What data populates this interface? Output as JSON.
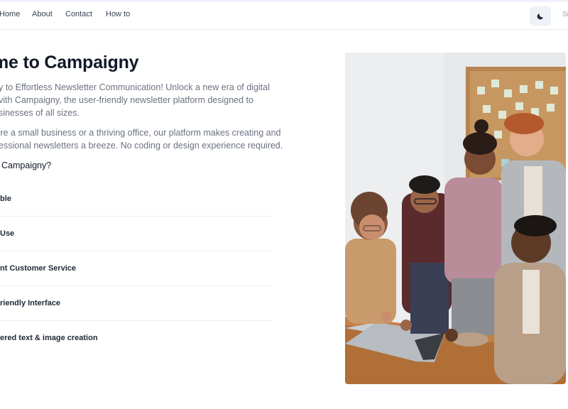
{
  "nav": {
    "links": [
      "Home",
      "About",
      "Contact",
      "How to"
    ],
    "theme_toggle_icon": "moon-icon",
    "signin_label": "Si"
  },
  "hero": {
    "title": "me to Campaigny",
    "paragraph1": [
      "y to Effortless Newsletter Communication! Unlock a new era of digital",
      "vith Campaigny, the user-friendly newsletter platform designed to",
      "sinesses of all sizes."
    ],
    "paragraph2": [
      "'re a small business or a thriving office, our platform makes creating and",
      "essional newsletters a breeze. No coding or design experience required."
    ],
    "why_heading": "Campaigny?",
    "features": [
      "ble",
      "Use",
      "nt Customer Service",
      "riendly Interface",
      "ered text & image creation"
    ]
  },
  "image": {
    "icon": "team-photo",
    "accent": "#b9834f"
  }
}
